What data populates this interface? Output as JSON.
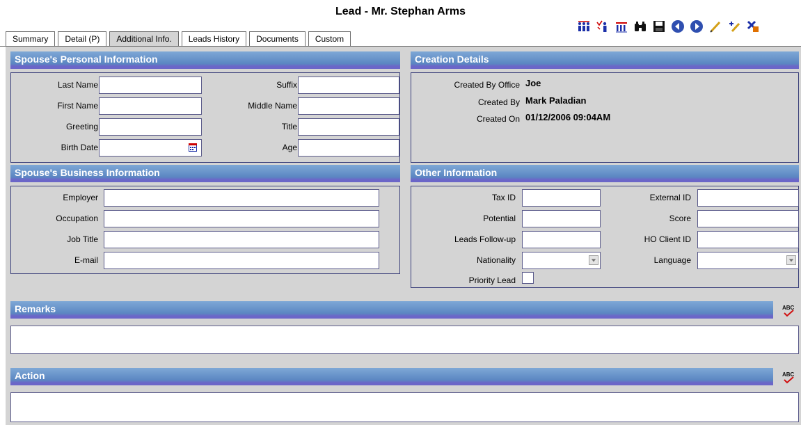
{
  "page": {
    "title": "Lead - Mr. Stephan Arms"
  },
  "toolbar": {
    "buttons": [
      {
        "icon": "people-group-icon"
      },
      {
        "icon": "person-check-icon"
      },
      {
        "icon": "people-list-icon"
      },
      {
        "icon": "binoculars-icon"
      },
      {
        "icon": "save-icon"
      },
      {
        "icon": "previous-icon"
      },
      {
        "icon": "next-icon"
      },
      {
        "icon": "edit-pencil-icon"
      },
      {
        "icon": "add-edit-icon"
      },
      {
        "icon": "delete-icon"
      }
    ]
  },
  "tabs": [
    {
      "label": "Summary"
    },
    {
      "label": "Detail (P)"
    },
    {
      "label": "Additional Info."
    },
    {
      "label": "Leads History"
    },
    {
      "label": "Documents"
    },
    {
      "label": "Custom"
    }
  ],
  "spouse_personal": {
    "header": "Spouse's Personal Information",
    "last_name": {
      "label": "Last Name",
      "value": ""
    },
    "first_name": {
      "label": "First Name",
      "value": ""
    },
    "greeting": {
      "label": "Greeting",
      "value": ""
    },
    "birth_date": {
      "label": "Birth Date",
      "value": ""
    },
    "suffix": {
      "label": "Suffix",
      "value": ""
    },
    "middle_name": {
      "label": "Middle Name",
      "value": ""
    },
    "title": {
      "label": "Title",
      "value": ""
    },
    "age": {
      "label": "Age",
      "value": ""
    }
  },
  "creation": {
    "header": "Creation Details",
    "office": {
      "label": "Created By Office",
      "value": "Joe"
    },
    "by": {
      "label": "Created By",
      "value": "Mark Paladian"
    },
    "on": {
      "label": "Created On",
      "value": "01/12/2006 09:04AM"
    }
  },
  "spouse_business": {
    "header": "Spouse's Business Information",
    "employer": {
      "label": "Employer",
      "value": ""
    },
    "occupation": {
      "label": "Occupation",
      "value": ""
    },
    "job_title": {
      "label": "Job Title",
      "value": ""
    },
    "email": {
      "label": "E-mail",
      "value": ""
    }
  },
  "other": {
    "header": "Other Information",
    "tax_id": {
      "label": "Tax ID",
      "value": ""
    },
    "potential": {
      "label": "Potential",
      "value": ""
    },
    "followup": {
      "label": "Leads Follow-up",
      "value": ""
    },
    "nationality": {
      "label": "Nationality",
      "value": ""
    },
    "priority": {
      "label": "Priority Lead",
      "checked": false
    },
    "external_id": {
      "label": "External ID",
      "value": ""
    },
    "score": {
      "label": "Score",
      "value": ""
    },
    "ho_client_id": {
      "label": "HO Client ID",
      "value": ""
    },
    "language": {
      "label": "Language",
      "value": ""
    }
  },
  "remarks": {
    "header": "Remarks",
    "value": ""
  },
  "action": {
    "header": "Action",
    "value": ""
  },
  "spell_check": {
    "text": "ABC"
  }
}
